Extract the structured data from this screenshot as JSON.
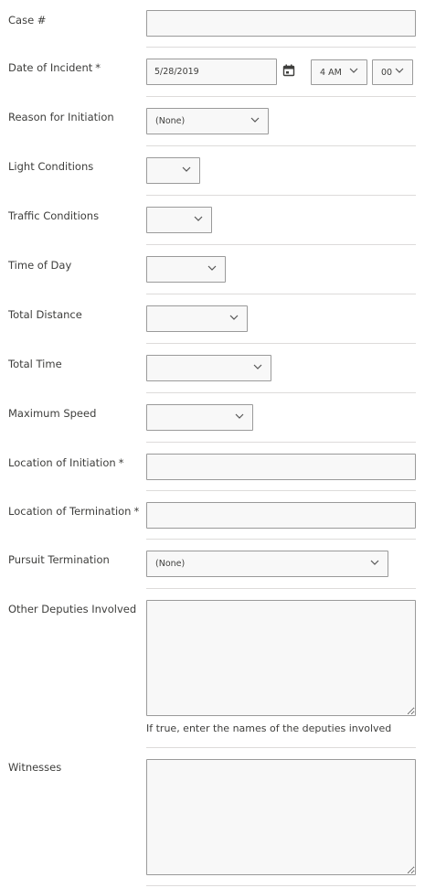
{
  "fields": {
    "case_number": {
      "label": "Case #",
      "value": ""
    },
    "date_of_incident": {
      "label": "Date of Incident",
      "required": "*",
      "date": "5/28/2019",
      "hour": "4 AM",
      "minute": "00"
    },
    "reason_for_initiation": {
      "label": "Reason for Initiation",
      "value": "(None)"
    },
    "light_conditions": {
      "label": "Light Conditions",
      "value": ""
    },
    "traffic_conditions": {
      "label": "Traffic Conditions",
      "value": ""
    },
    "time_of_day": {
      "label": "Time of Day",
      "value": ""
    },
    "total_distance": {
      "label": "Total Distance",
      "value": ""
    },
    "total_time": {
      "label": "Total Time",
      "value": ""
    },
    "maximum_speed": {
      "label": "Maximum Speed",
      "value": ""
    },
    "location_of_initiation": {
      "label": "Location of Initiation",
      "required": "*",
      "value": ""
    },
    "location_of_termination": {
      "label": "Location of Termination",
      "required": "*",
      "value": ""
    },
    "pursuit_termination": {
      "label": "Pursuit Termination",
      "value": "(None)"
    },
    "other_deputies_involved": {
      "label": "Other Deputies Involved",
      "value": "",
      "help": "If true, enter the names of the deputies involved"
    },
    "witnesses": {
      "label": "Witnesses",
      "value": ""
    }
  },
  "icons": {
    "calendar": "calendar-icon",
    "dropdown": "chevron-down-icon"
  },
  "colors": {
    "border": "#9a9a9a",
    "field_bg": "#f8f8f8",
    "separator": "#dddbda",
    "text": "#3e3e3c"
  }
}
